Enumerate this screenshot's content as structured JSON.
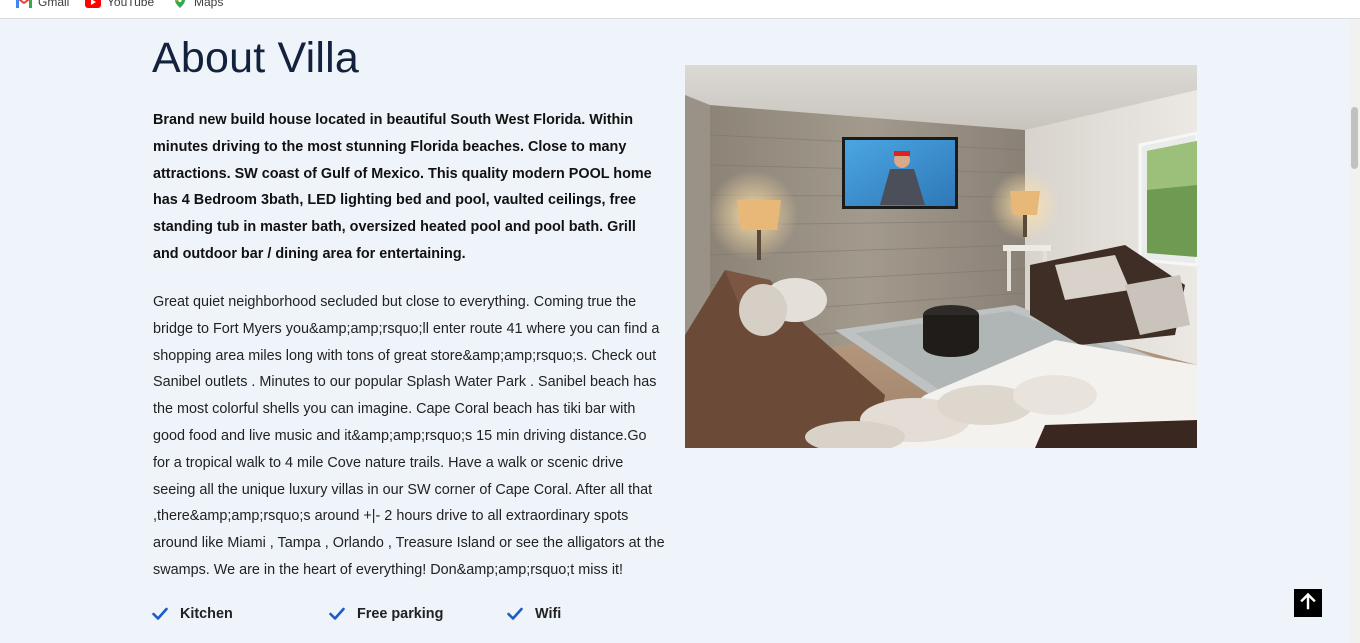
{
  "bookmarks": [
    {
      "label": "Gmail",
      "icon": "gmail-icon"
    },
    {
      "label": "YouTube",
      "icon": "youtube-icon"
    },
    {
      "label": "Maps",
      "icon": "maps-icon"
    }
  ],
  "section": {
    "title": "About Villa",
    "intro": "Brand new build house located in beautiful South West Florida. Within minutes driving to the most stunning Florida beaches. Close to many attractions. SW coast of Gulf of Mexico. This quality modern POOL home has 4 Bedroom 3bath, LED lighting bed and pool, vaulted ceilings, free standing tub in master bath, oversized heated pool and pool bath. Grill and outdoor bar / dining area for entertaining.",
    "description": "Great quiet neighborhood secluded but close to everything. Coming true the bridge to Fort Myers you&amp;amp;rsquo;ll enter route 41 where you can find a shopping area miles long with tons of great store&amp;amp;rsquo;s. Check out Sanibel outlets . Minutes to our popular Splash Water Park . Sanibel beach has the most colorful shells you can imagine. Cape Coral beach has tiki bar with good food and live music and it&amp;amp;rsquo;s 15 min driving distance.Go for a tropical walk to 4 mile Cove nature trails. Have a walk or scenic drive seeing all the unique luxury villas in our SW corner of Cape Coral. After all that ,there&amp;amp;rsquo;s around +|- 2 hours drive to all extraordinary spots around like Miami , Tampa , Orlando , Treasure Island or see the alligators at the swamps. We are in the heart of everything! Don&amp;amp;rsquo;t miss it!"
  },
  "amenities": [
    {
      "label": "Kitchen",
      "icon": "check-icon"
    },
    {
      "label": "Free parking",
      "icon": "check-icon"
    },
    {
      "label": "Wifi",
      "icon": "check-icon"
    }
  ],
  "colors": {
    "page_bg": "#eff4fb",
    "title": "#14213d",
    "check": "#1a5cc8",
    "scroll_top_bg": "#000000"
  },
  "scroll_top": {
    "icon": "arrow-up-icon"
  }
}
